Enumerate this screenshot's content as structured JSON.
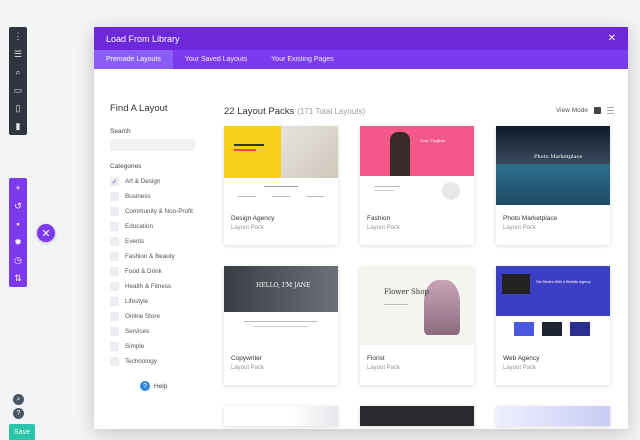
{
  "modal": {
    "title": "Load From Library",
    "tabs": [
      {
        "label": "Premade Layouts",
        "active": true
      },
      {
        "label": "Your Saved Layouts",
        "active": false
      },
      {
        "label": "Your Existing Pages",
        "active": false
      }
    ]
  },
  "sidebar": {
    "heading": "Find A Layout",
    "search_label": "Search",
    "categories_label": "Categories",
    "categories": [
      {
        "label": "Art & Design",
        "checked": true
      },
      {
        "label": "Business",
        "checked": false
      },
      {
        "label": "Community & Non-Profit",
        "checked": false
      },
      {
        "label": "Education",
        "checked": false
      },
      {
        "label": "Events",
        "checked": false
      },
      {
        "label": "Fashion & Beauty",
        "checked": false
      },
      {
        "label": "Food & Drink",
        "checked": false
      },
      {
        "label": "Health & Fitness",
        "checked": false
      },
      {
        "label": "Lifestyle",
        "checked": false
      },
      {
        "label": "Online Store",
        "checked": false
      },
      {
        "label": "Services",
        "checked": false
      },
      {
        "label": "Simple",
        "checked": false
      },
      {
        "label": "Technology",
        "checked": false
      }
    ],
    "help_label": "Help"
  },
  "content": {
    "count_label": "22 Layout Packs",
    "total_label": "(171 Total Layouts)",
    "view_mode_label": "View Mode",
    "cards": [
      {
        "name": "Design Agency",
        "sub": "Layout Pack",
        "thumb": "agency"
      },
      {
        "name": "Fashion",
        "sub": "Layout Pack",
        "thumb": "fashion",
        "thumb_text": "Your Tagline"
      },
      {
        "name": "Photo Marketplace",
        "sub": "Layout Pack",
        "thumb": "photo",
        "thumb_text": "Photo Marketplace"
      },
      {
        "name": "Copywriter",
        "sub": "Layout Pack",
        "thumb": "copy",
        "thumb_text": "HELLO, I'M JANE"
      },
      {
        "name": "Florist",
        "sub": "Layout Pack",
        "thumb": "flower",
        "thumb_text": "Flower Shop"
      },
      {
        "name": "Web Agency",
        "sub": "Layout Pack",
        "thumb": "web",
        "thumb_text": "Get Started With A Website Agency"
      }
    ]
  },
  "toolbar": {
    "save_label": "Save"
  },
  "colors": {
    "purple_header": "#6d28d9",
    "purple_tabs": "#7c3aed",
    "save_green": "#29c4a9",
    "dark_toolbar": "#2f3440"
  }
}
